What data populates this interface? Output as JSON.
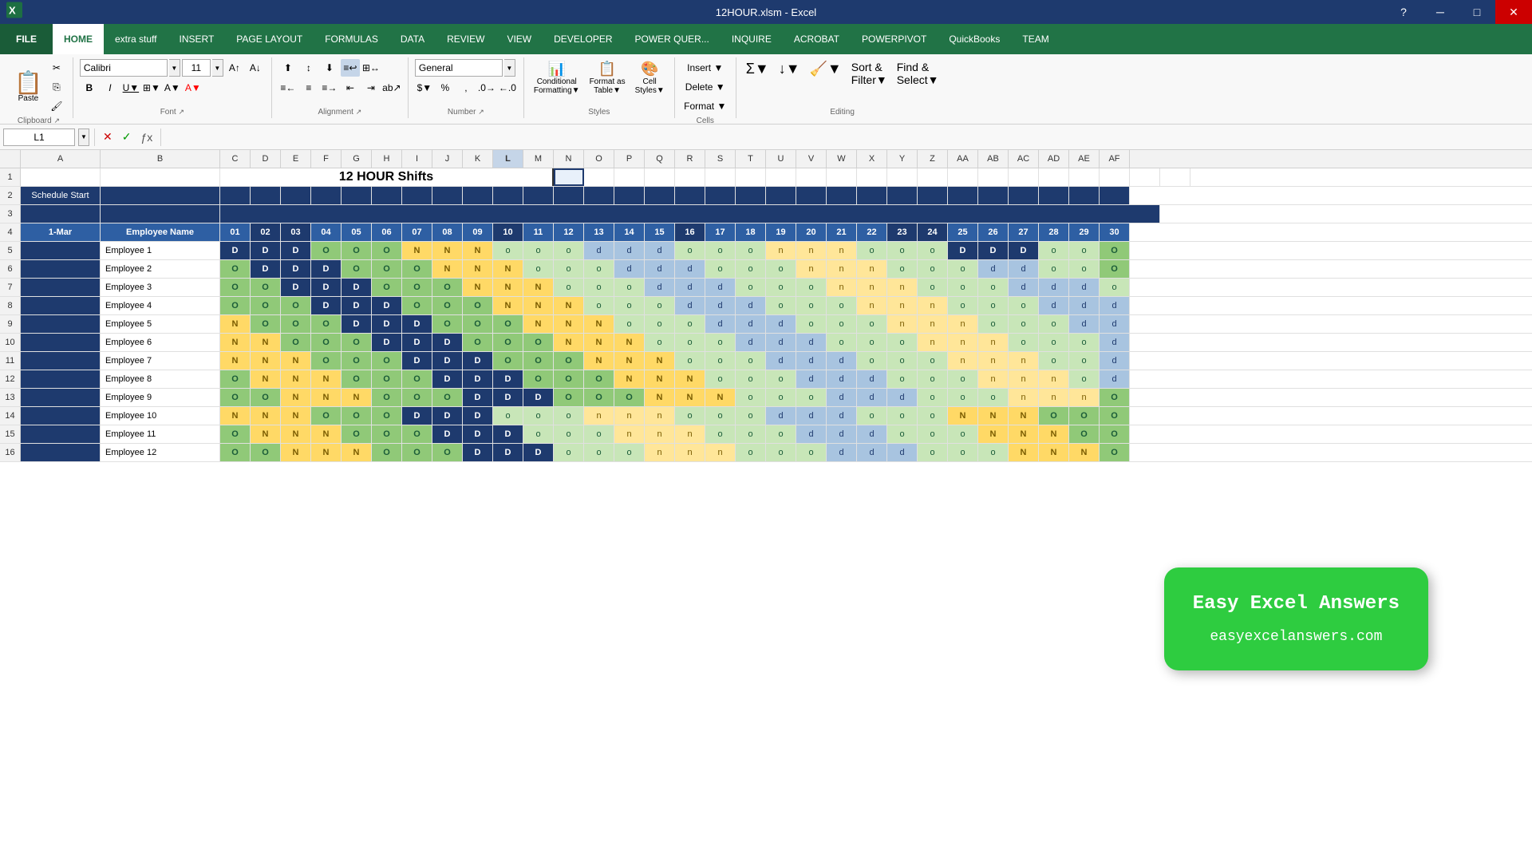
{
  "titleBar": {
    "title": "12HOUR.xlsm - Excel",
    "excelIcon": "X",
    "windowControls": [
      "─",
      "□",
      "✕"
    ]
  },
  "menuBar": {
    "items": [
      {
        "id": "file",
        "label": "FILE",
        "active": false
      },
      {
        "id": "home",
        "label": "HOME",
        "active": true
      },
      {
        "id": "extrastuff",
        "label": "extra stuff",
        "active": false
      },
      {
        "id": "insert",
        "label": "INSERT",
        "active": false
      },
      {
        "id": "pagelayout",
        "label": "PAGE LAYOUT",
        "active": false
      },
      {
        "id": "formulas",
        "label": "FORMULAS",
        "active": false
      },
      {
        "id": "data",
        "label": "DATA",
        "active": false
      },
      {
        "id": "review",
        "label": "REVIEW",
        "active": false
      },
      {
        "id": "view",
        "label": "VIEW",
        "active": false
      },
      {
        "id": "developer",
        "label": "DEVELOPER",
        "active": false
      },
      {
        "id": "powerquery",
        "label": "POWER QUER...",
        "active": false
      },
      {
        "id": "inquire",
        "label": "INQUIRE",
        "active": false
      },
      {
        "id": "acrobat",
        "label": "ACROBAT",
        "active": false
      },
      {
        "id": "powerpivot",
        "label": "POWERPIVOT",
        "active": false
      },
      {
        "id": "quickbooks",
        "label": "QuickBooks",
        "active": false
      },
      {
        "id": "team",
        "label": "TEAM",
        "active": false
      }
    ]
  },
  "ribbon": {
    "fontName": "Calibri",
    "fontSize": "11",
    "numberFormat": "General"
  },
  "formulaBar": {
    "cellRef": "L1",
    "formula": ""
  },
  "columns": {
    "letters": [
      "A",
      "B",
      "C",
      "D",
      "E",
      "F",
      "G",
      "H",
      "I",
      "J",
      "K",
      "L",
      "M",
      "N",
      "O",
      "P",
      "Q",
      "R",
      "S",
      "T",
      "U",
      "V",
      "W",
      "X",
      "Y",
      "Z",
      "AA",
      "AB",
      "AC",
      "AD",
      "AE",
      "AF"
    ],
    "widths": [
      100,
      150,
      38,
      38,
      38,
      38,
      38,
      38,
      38,
      38,
      38,
      38,
      38,
      38,
      38,
      38,
      38,
      38,
      38,
      38,
      38,
      38,
      38,
      38,
      38,
      38,
      38,
      38,
      38,
      38,
      38,
      38
    ]
  },
  "spreadsheet": {
    "title": "12 HOUR  Shifts",
    "scheduleStart": "Schedule Start",
    "dateLabel": "1-Mar",
    "employeeColHeader": "Employee Name",
    "dayNumbers": [
      "01",
      "02",
      "03",
      "04",
      "05",
      "06",
      "07",
      "08",
      "09",
      "10",
      "11",
      "12",
      "13",
      "14",
      "15",
      "16",
      "17",
      "18",
      "19",
      "20",
      "21",
      "22",
      "23",
      "24",
      "25",
      "26",
      "27",
      "28",
      "29",
      "30"
    ],
    "employees": [
      {
        "name": "Employee 1",
        "shifts": [
          "D",
          "D",
          "D",
          "O",
          "O",
          "O",
          "N",
          "N",
          "N",
          "o",
          "o",
          "o",
          "d",
          "d",
          "d",
          "o",
          "o",
          "o",
          "n",
          "n",
          "n",
          "o",
          "o",
          "o",
          "D",
          "D",
          "D",
          "o",
          "o",
          "O"
        ]
      },
      {
        "name": "Employee 2",
        "shifts": [
          "O",
          "D",
          "D",
          "D",
          "O",
          "O",
          "O",
          "N",
          "N",
          "N",
          "o",
          "o",
          "o",
          "d",
          "d",
          "d",
          "o",
          "o",
          "o",
          "n",
          "n",
          "n",
          "o",
          "o",
          "o",
          "d",
          "d",
          "o",
          "o",
          "O"
        ]
      },
      {
        "name": "Employee 3",
        "shifts": [
          "O",
          "O",
          "D",
          "D",
          "D",
          "O",
          "O",
          "O",
          "N",
          "N",
          "N",
          "o",
          "o",
          "o",
          "d",
          "d",
          "d",
          "o",
          "o",
          "o",
          "n",
          "n",
          "n",
          "o",
          "o",
          "o",
          "d",
          "d",
          "d",
          "o"
        ]
      },
      {
        "name": "Employee 4",
        "shifts": [
          "O",
          "O",
          "O",
          "D",
          "D",
          "D",
          "O",
          "O",
          "O",
          "N",
          "N",
          "N",
          "o",
          "o",
          "o",
          "d",
          "d",
          "d",
          "o",
          "o",
          "o",
          "n",
          "n",
          "n",
          "o",
          "o",
          "o",
          "d",
          "d",
          "d"
        ]
      },
      {
        "name": "Employee 5",
        "shifts": [
          "N",
          "O",
          "O",
          "O",
          "D",
          "D",
          "D",
          "O",
          "O",
          "O",
          "N",
          "N",
          "N",
          "o",
          "o",
          "o",
          "d",
          "d",
          "d",
          "o",
          "o",
          "o",
          "n",
          "n",
          "n",
          "o",
          "o",
          "o",
          "d",
          "d"
        ]
      },
      {
        "name": "Employee 6",
        "shifts": [
          "N",
          "N",
          "O",
          "O",
          "O",
          "D",
          "D",
          "D",
          "O",
          "O",
          "O",
          "N",
          "N",
          "N",
          "o",
          "o",
          "o",
          "d",
          "d",
          "d",
          "o",
          "o",
          "o",
          "n",
          "n",
          "n",
          "o",
          "o",
          "o",
          "d"
        ]
      },
      {
        "name": "Employee 7",
        "shifts": [
          "N",
          "N",
          "N",
          "O",
          "O",
          "O",
          "D",
          "D",
          "D",
          "O",
          "O",
          "O",
          "N",
          "N",
          "N",
          "o",
          "o",
          "o",
          "d",
          "d",
          "d",
          "o",
          "o",
          "o",
          "n",
          "n",
          "n",
          "o",
          "o",
          "d"
        ]
      },
      {
        "name": "Employee 8",
        "shifts": [
          "O",
          "N",
          "N",
          "N",
          "O",
          "O",
          "O",
          "D",
          "D",
          "D",
          "O",
          "O",
          "O",
          "N",
          "N",
          "N",
          "o",
          "o",
          "o",
          "d",
          "d",
          "d",
          "o",
          "o",
          "o",
          "n",
          "n",
          "n",
          "o",
          "d"
        ]
      },
      {
        "name": "Employee 9",
        "shifts": [
          "O",
          "O",
          "N",
          "N",
          "N",
          "O",
          "O",
          "O",
          "D",
          "D",
          "D",
          "O",
          "O",
          "O",
          "N",
          "N",
          "N",
          "o",
          "o",
          "o",
          "d",
          "d",
          "d",
          "o",
          "o",
          "o",
          "n",
          "n",
          "n",
          "O"
        ]
      },
      {
        "name": "Employee 10",
        "shifts": [
          "N",
          "N",
          "N",
          "O",
          "O",
          "O",
          "D",
          "D",
          "D",
          "o",
          "o",
          "o",
          "n",
          "n",
          "n",
          "o",
          "o",
          "o",
          "d",
          "d",
          "d",
          "o",
          "o",
          "o",
          "N",
          "N",
          "N",
          "O",
          "O",
          "O"
        ]
      },
      {
        "name": "Employee 11",
        "shifts": [
          "O",
          "N",
          "N",
          "N",
          "O",
          "O",
          "O",
          "D",
          "D",
          "D",
          "o",
          "o",
          "o",
          "n",
          "n",
          "n",
          "o",
          "o",
          "o",
          "d",
          "d",
          "d",
          "o",
          "o",
          "o",
          "N",
          "N",
          "N",
          "O",
          "O"
        ]
      },
      {
        "name": "Employee 12",
        "shifts": [
          "O",
          "O",
          "N",
          "N",
          "N",
          "O",
          "O",
          "O",
          "D",
          "D",
          "D",
          "o",
          "o",
          "o",
          "n",
          "n",
          "n",
          "o",
          "o",
          "o",
          "d",
          "d",
          "d",
          "o",
          "o",
          "o",
          "N",
          "N",
          "N",
          "O"
        ]
      }
    ]
  },
  "overlay": {
    "line1": "Easy Excel Answers",
    "line2": "easyexcelanswers.com"
  }
}
